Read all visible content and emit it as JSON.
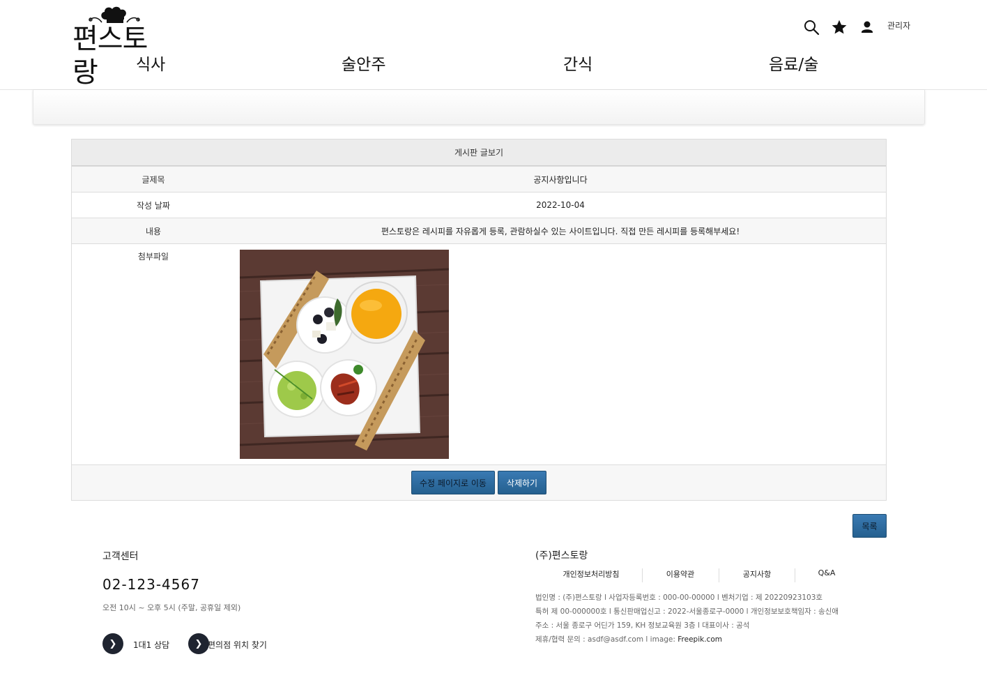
{
  "header": {
    "logo_text": "편스토랑",
    "nav": [
      "식사",
      "술안주",
      "간식",
      "음료/술"
    ],
    "icons": [
      "search-icon",
      "star-icon",
      "user-icon"
    ],
    "admin_label": "관리자"
  },
  "board": {
    "title": "게시판 글보기",
    "rows": [
      {
        "label": "글제목",
        "value": "공지사항입니다"
      },
      {
        "label": "작성 날짜",
        "value": "2022-10-04"
      },
      {
        "label": "내용",
        "value": "편스토랑은 레시피를 자유롭게 등록, 관람하실수 있는 사이트입니다. 직접 만든 레시피를 등록해부세요!"
      },
      {
        "label": "첨부파일",
        "value": ""
      }
    ],
    "edit_button": "수정 페이지로 이동",
    "delete_button": "삭제하기",
    "list_button": "목록"
  },
  "footer": {
    "cs_title": "고객센터",
    "phone": "02-123-4567",
    "hours": "오전 10시 ~ 오후 5시 (주말, 공휴일 제외)",
    "link1": "1대1 상담",
    "link2": "편의점 위치 찾기",
    "company_title": "(주)편스토랑",
    "menu": [
      "개인정보처리방침",
      "이용약관",
      "공지사항",
      "Q&A"
    ],
    "info_lines": [
      "법인명 : (주)편스토랑 l 사업자등록번호 : 000-00-00000 l 벤처기업 : 제 20220923103호",
      "특허 제 00-000000호 l 통신판매업신고 : 2022-서울종로구-0000 l 개인정보보호책임자 : 송신애",
      "주소 : 서울 종로구 어딘가 159, KH 정보교육원 3층 l 대표이사 : 공석",
      "제휴/협력 문의 : asdf@asdf.com l image: "
    ],
    "freepik": "Freepik.com"
  },
  "colors": {
    "button": "#2f6fa6",
    "table_header": "#ececec",
    "footer_circle": "#1f2430"
  }
}
